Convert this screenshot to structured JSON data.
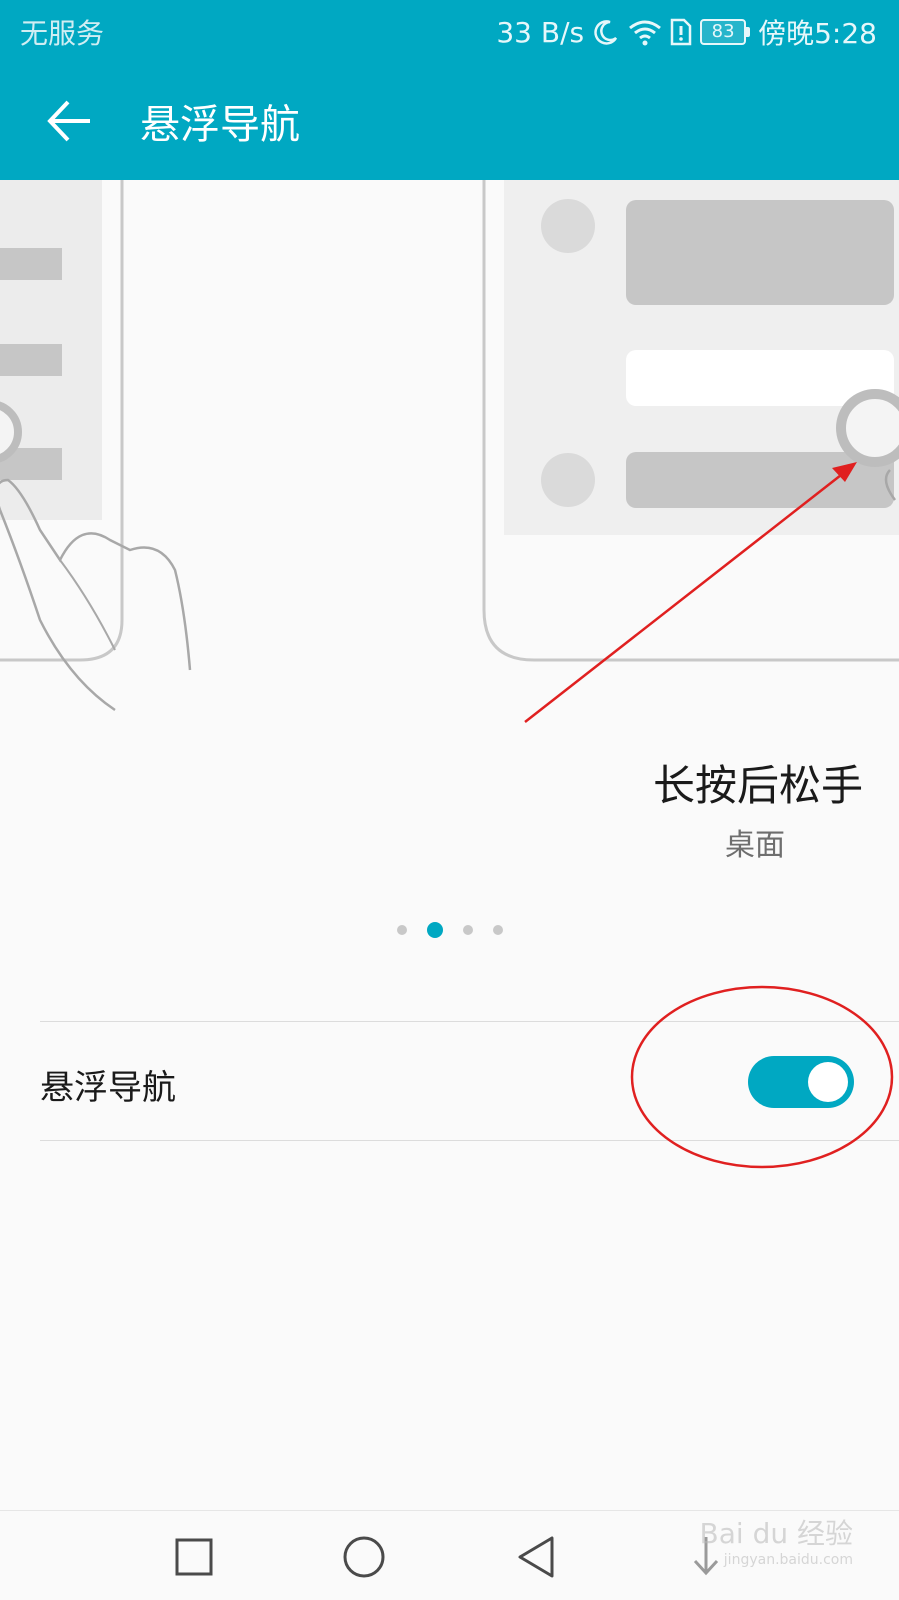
{
  "status_bar": {
    "carrier": "无服务",
    "net_speed": "33 B/s",
    "battery": "83",
    "time": "傍晚5:28",
    "icons": [
      "moon-icon",
      "wifi-icon",
      "sim-alert-icon",
      "battery-icon"
    ]
  },
  "app_bar": {
    "title": "悬浮导航",
    "back_icon": "back-arrow-icon"
  },
  "illustration": {
    "caption_title": "长按后松手",
    "caption_subtitle": "桌面",
    "page_count": 4,
    "active_page": 1
  },
  "setting": {
    "label": "悬浮导航",
    "enabled": true
  },
  "nav_bar": {
    "icons": [
      "recent-apps-icon",
      "home-icon",
      "back-icon",
      "menu-down-icon"
    ]
  },
  "watermark": {
    "text": "Bai du 经验",
    "url": "jingyan.baidu.com"
  },
  "colors": {
    "accent": "#00a8c2",
    "annotation_red": "#e02020"
  }
}
